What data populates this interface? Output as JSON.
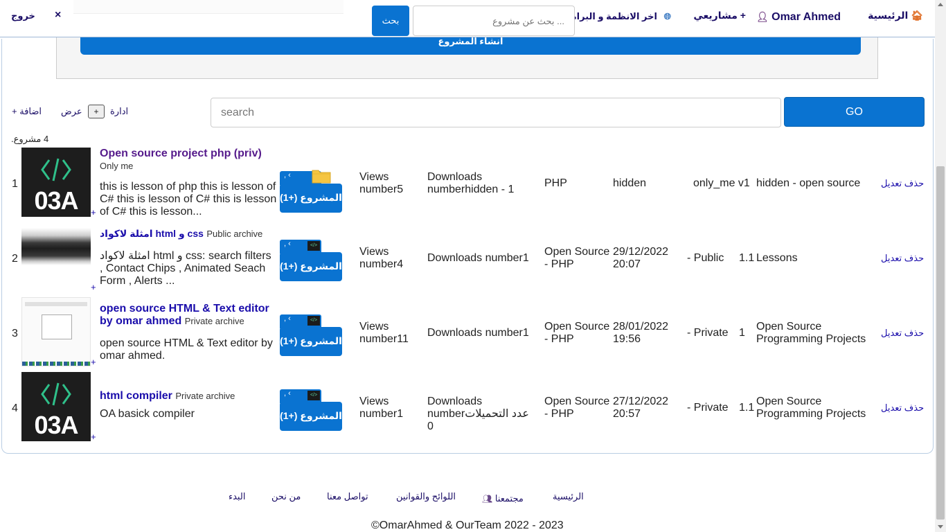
{
  "nav": {
    "home": "الرئيسية",
    "user": "Omar Ahmed",
    "my_projects": "مشاريعي +",
    "latest": "اخر الانظمة و البرامج",
    "search_placeholder": "... بحث عن مشروع",
    "search_button": "بحث",
    "close": "×",
    "logout": "خروج"
  },
  "create_panel": {
    "button": "انشاء المشروع"
  },
  "toolbar": {
    "add": "+ اضافة",
    "view": "عرض",
    "plus": "+",
    "manage": "ادارة",
    "search_placeholder": "search",
    "go": "GO"
  },
  "count": "4 مشروع.",
  "projects": [
    {
      "num": "1",
      "thumb": "03A",
      "thumb_plus": "+",
      "title": "Open source project php (priv)",
      "visibility": "Only me",
      "desc": "this is lesson of php this is lesson of C# this is lesson of C# this is lesson of C# this is lesson...",
      "badge": "المشروع (+1)",
      "views": "Views number5",
      "downloads": "Downloads numberhidden - 1",
      "language": "PHP",
      "date": "hidden",
      "vis_col": "only_me v1",
      "version": "",
      "category": "hidden - open source",
      "actions": "حذف تعديل"
    },
    {
      "num": "2",
      "thumb": "",
      "thumb_plus": "+",
      "title": "امثلة لاكواد html و css",
      "visibility": "Public archive",
      "desc": "امثلة لاكواد html و css: search filters , Contact Chips , Animated Seach Form , Alerts ...",
      "badge": "المشروع (+1)",
      "views": "Views number4",
      "downloads": "Downloads number1",
      "language": "Open Source - PHP",
      "date": "29/12/2022 20:07",
      "vis_col": "- Public",
      "version": "1.1",
      "category": "Lessons",
      "actions": "حذف تعديل"
    },
    {
      "num": "3",
      "thumb": "",
      "thumb_plus": "+",
      "title": "open source HTML & Text editor by omar ahmed",
      "visibility": "Private archive",
      "desc": "open source HTML & Text editor by omar ahmed.",
      "badge": "المشروع (+1)",
      "views": "Views number11",
      "downloads": "Downloads number1",
      "language": "Open Source - PHP",
      "date": "28/01/2022 19:56",
      "vis_col": "- Private",
      "version": "1",
      "category": "Open Source Programming Projects",
      "actions": "حذف تعديل"
    },
    {
      "num": "4",
      "thumb": "03A",
      "thumb_plus": "+",
      "title": "html compiler",
      "visibility": "Private archive",
      "desc": "OA basick compiler",
      "badge": "المشروع (+1)",
      "views": "Views number1",
      "downloads": "Downloads numberعدد التحميلات 0",
      "language": "Open Source - PHP",
      "date": "27/12/2022 20:57",
      "vis_col": "- Private",
      "version": "1.1",
      "category": "Open Source Programming Projects",
      "actions": "حذف تعديل"
    }
  ],
  "footer": {
    "home": "الرئيسية",
    "community": "مجتمعنا",
    "rules": "اللوائح والقوانين",
    "contact": "تواصل معنا",
    "about": "من نحن",
    "start": "البدء",
    "copyright": "©OmarAhmed & OurTeam 2022 - 2023"
  },
  "colors": {
    "accent": "#0a73d1",
    "link": "#1a0dab",
    "nav_text": "#1a0d66"
  }
}
